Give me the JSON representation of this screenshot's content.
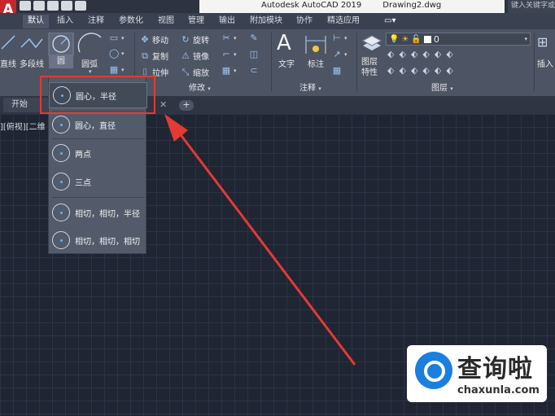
{
  "app": {
    "logo_letter": "A",
    "title": "Autodesk AutoCAD 2019",
    "document": "Drawing2.dwg",
    "search_placeholder": "键入关键字或短语"
  },
  "ribbon_tabs": [
    "默认",
    "插入",
    "注释",
    "参数化",
    "视图",
    "管理",
    "输出",
    "附加模块",
    "协作",
    "精选应用"
  ],
  "draw_panel": {
    "line": "直线",
    "polyline": "多段线",
    "circle": "圆",
    "arc": "圆弧"
  },
  "modify_panel": {
    "label": "修改",
    "move": "移动",
    "rotate": "旋转",
    "copy": "复制",
    "mirror": "镜像",
    "stretch": "拉伸",
    "scale": "缩放"
  },
  "annotation_panel": {
    "label": "注释",
    "text": "文字",
    "dimension": "标注"
  },
  "layers_panel": {
    "label": "图层",
    "layer_properties": "图层\n特性",
    "current_layer": "0"
  },
  "insert_panel": {
    "insert": "插入"
  },
  "file_tabs": {
    "start": "开始",
    "close": "✕",
    "new": "+"
  },
  "viewport_label": "][俯视][二维",
  "circle_menu": [
    "圆心，半径",
    "圆心，直径",
    "两点",
    "三点",
    "相切，相切，半径",
    "相切，相切，相切"
  ],
  "watermark": {
    "name": "查询啦",
    "url": "chaxunla.com"
  },
  "colors": {
    "accent_red": "#e33a33",
    "canvas": "#1f2533",
    "ribbon": "#4d5564"
  }
}
